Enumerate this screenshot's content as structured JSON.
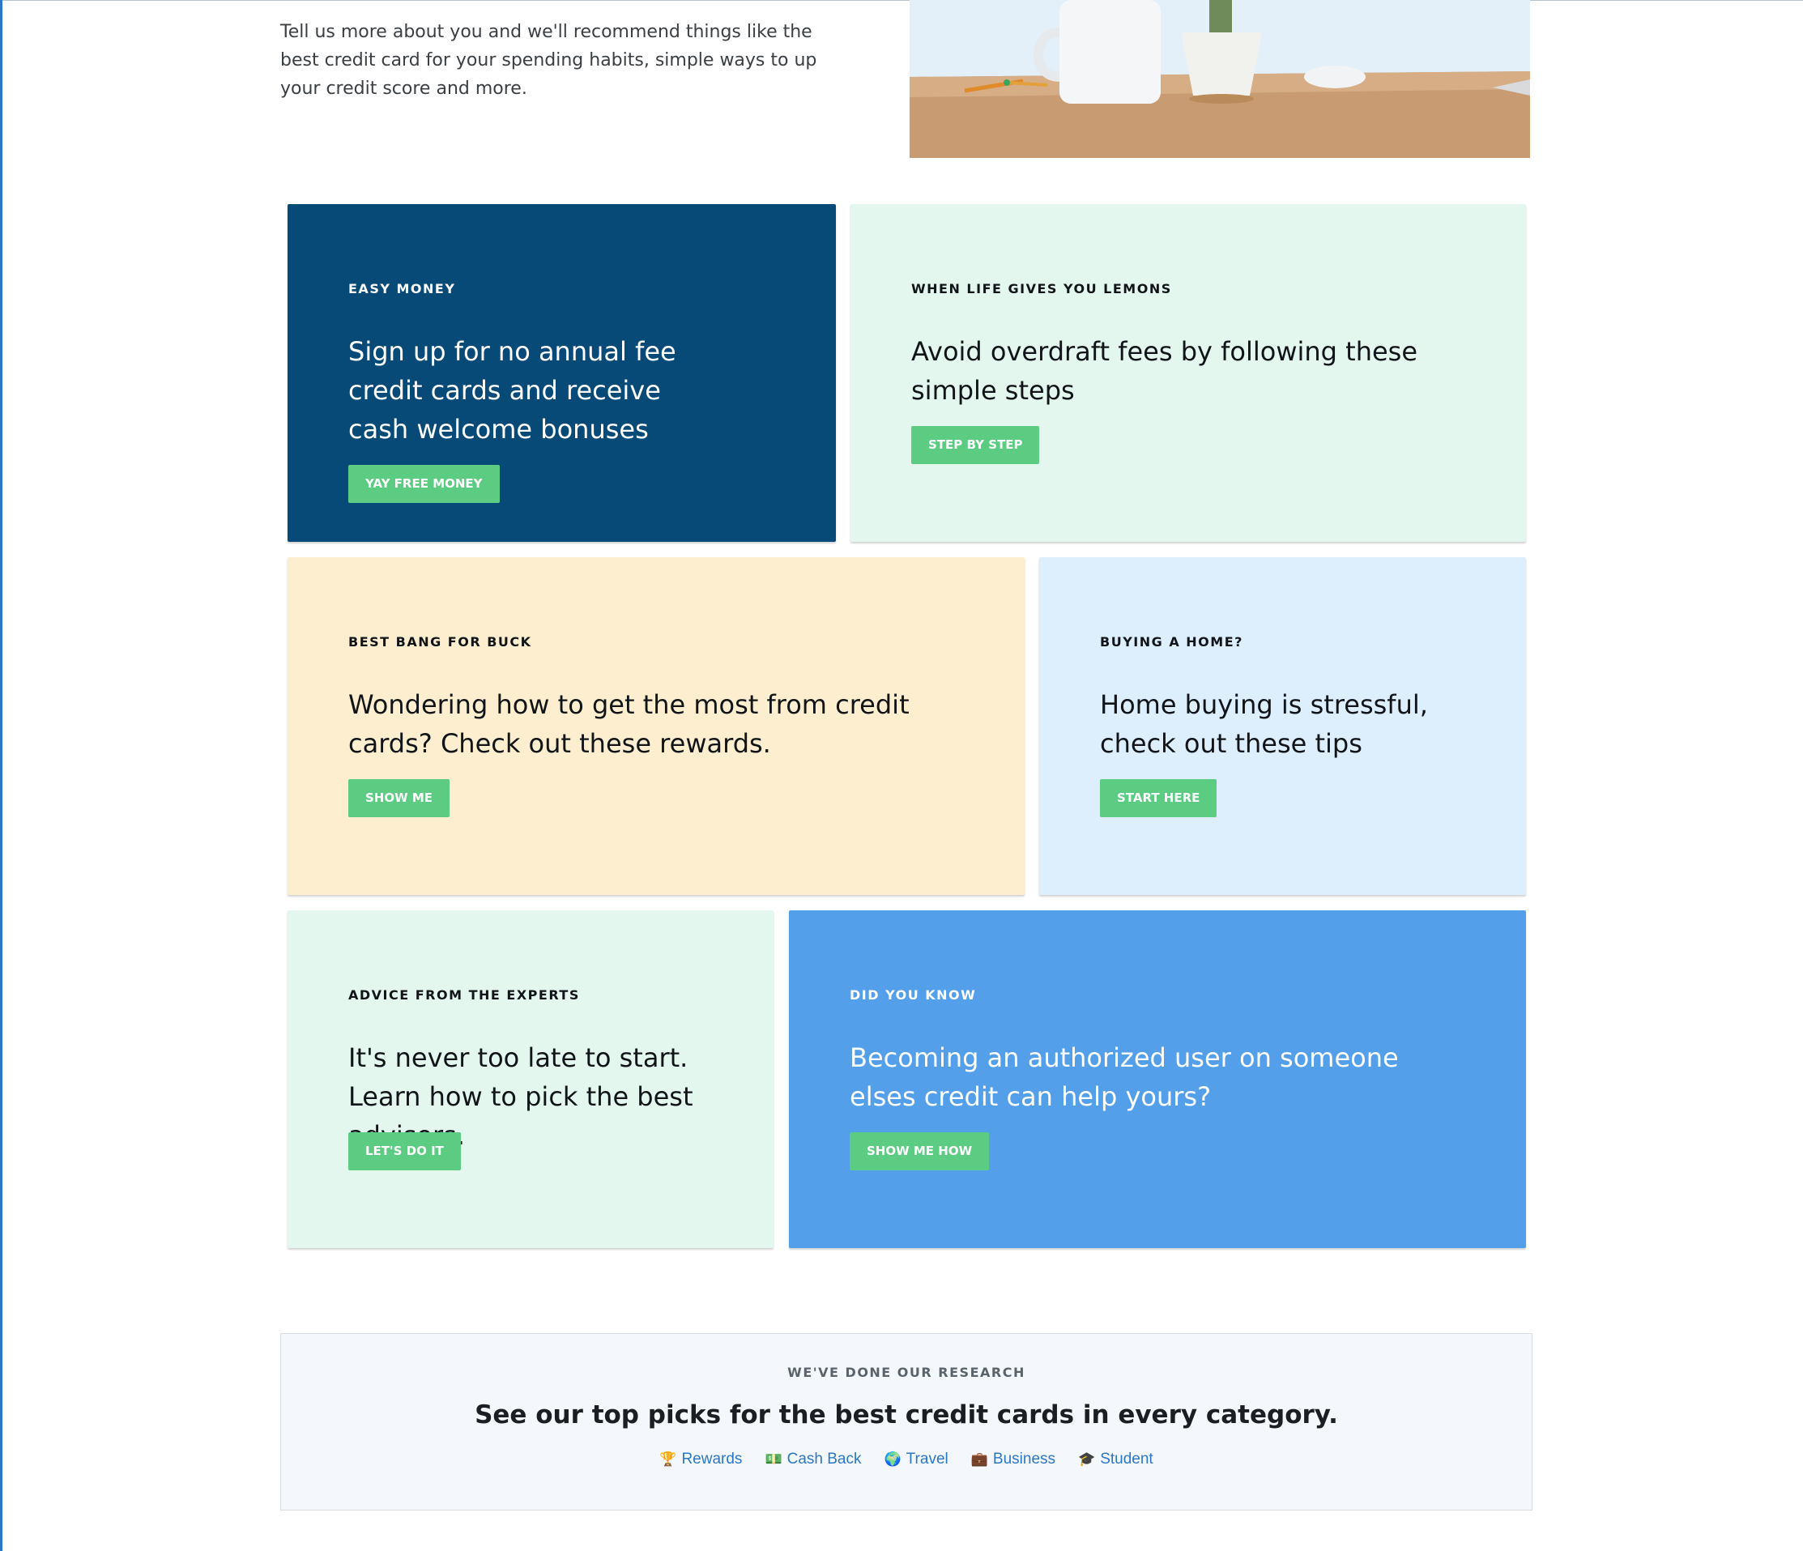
{
  "intro": {
    "text": "Tell us more about you and we'll recommend things like the best credit card for your spending habits, simple ways to up your credit score and more."
  },
  "cards": [
    {
      "eyebrow": "EASY MONEY",
      "headline": "Sign up for no annual fee credit cards and receive cash welcome bonuses",
      "cta": "YAY FREE MONEY",
      "bg": "#074a78"
    },
    {
      "eyebrow": "WHEN LIFE GIVES YOU LEMONS",
      "headline": "Avoid overdraft fees by following these simple steps",
      "cta": "STEP BY STEP",
      "bg": "#e3f7ef"
    },
    {
      "eyebrow": "BEST BANG FOR BUCK",
      "headline": "Wondering how to get the most from credit cards? Check out these rewards.",
      "cta": "SHOW ME",
      "bg": "#fdeecf"
    },
    {
      "eyebrow": "BUYING A HOME?",
      "headline": "Home buying is stressful, check out these tips",
      "cta": "START HERE",
      "bg": "#ddeefd"
    },
    {
      "eyebrow": "ADVICE FROM THE EXPERTS",
      "headline": "It's never too late to start. Learn how to pick the best advisors.",
      "cta": "LET'S DO IT",
      "bg": "#e3f7ef"
    },
    {
      "eyebrow": "DID YOU KNOW",
      "headline": "Becoming an authorized user on someone elses credit can help yours?",
      "cta": "SHOW ME HOW",
      "bg": "#539fe9"
    }
  ],
  "research": {
    "eyebrow": "WE'VE DONE OUR RESEARCH",
    "title": "See our top picks for the best credit cards in every category.",
    "links": [
      {
        "label": "Rewards",
        "icon": "trophy-icon",
        "glyph": "🏆"
      },
      {
        "label": "Cash Back",
        "icon": "cash-icon",
        "glyph": "💵"
      },
      {
        "label": "Travel",
        "icon": "globe-icon",
        "glyph": "🌍"
      },
      {
        "label": "Business",
        "icon": "briefcase-icon",
        "glyph": "💼"
      },
      {
        "label": "Student",
        "icon": "graduation-cap-icon",
        "glyph": "🎓"
      }
    ]
  },
  "colors": {
    "cta_green": "#5bcc82",
    "link_blue": "#2b77c8"
  }
}
